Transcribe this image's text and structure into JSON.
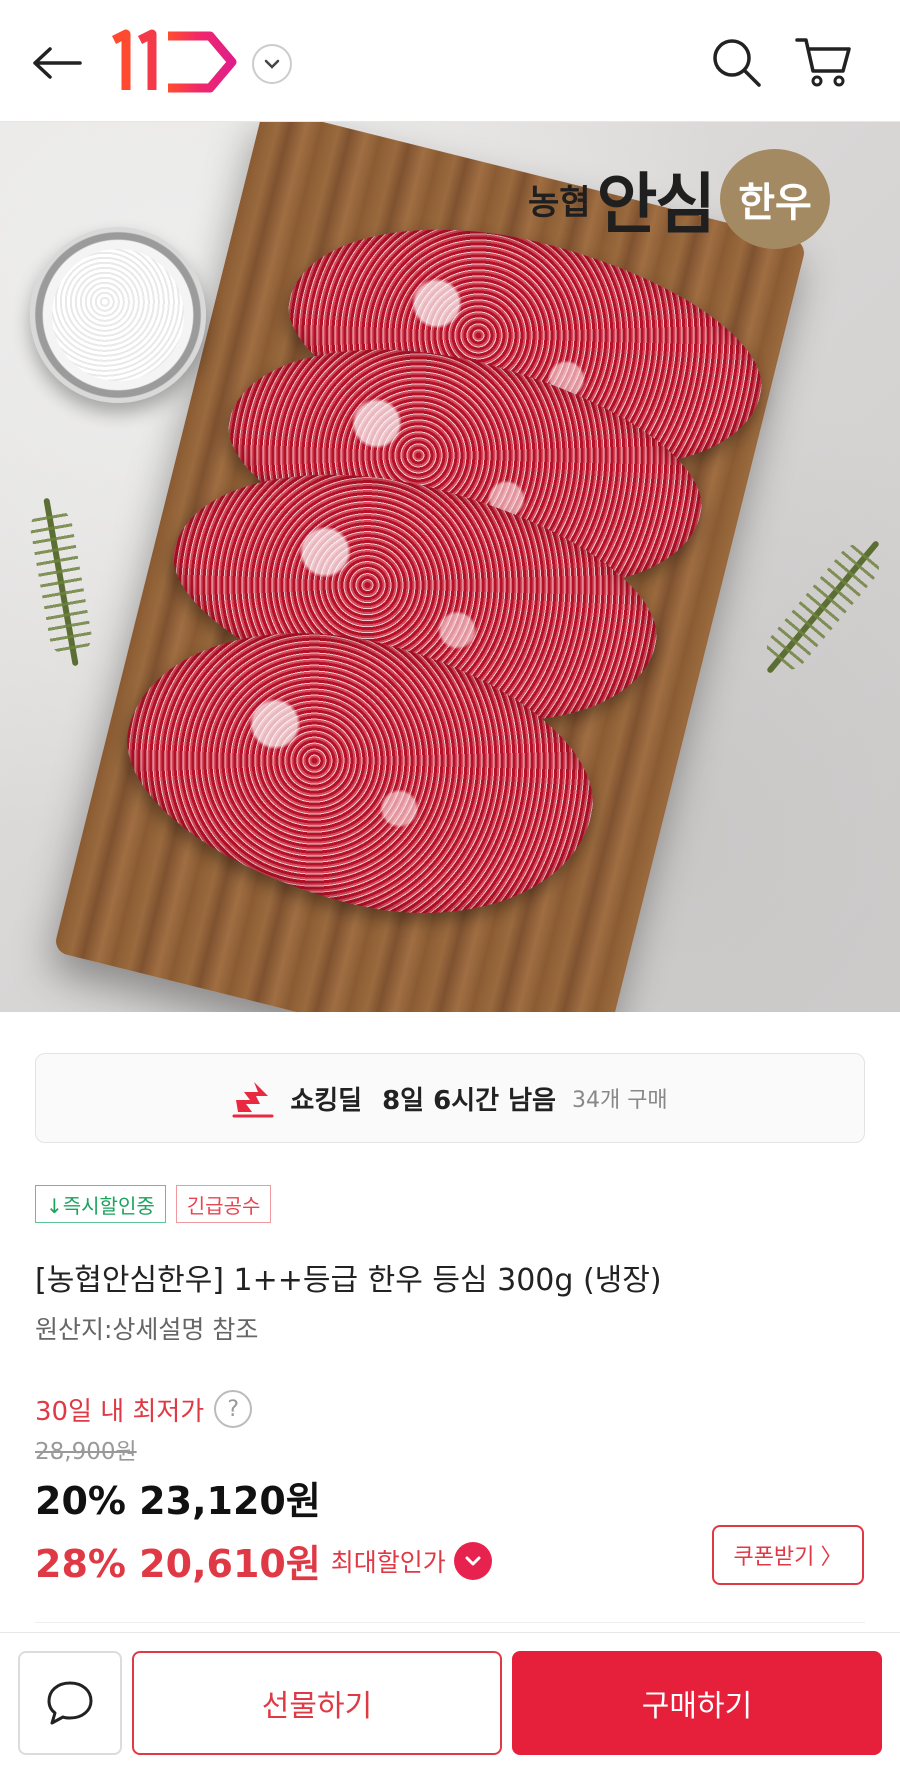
{
  "header": {
    "logo_text": "11",
    "back_icon": "arrow-left-icon",
    "search_icon": "search-icon",
    "cart_icon": "cart-icon",
    "dropdown_icon": "chevron-down-icon"
  },
  "hero": {
    "brand_part1": "농협",
    "brand_part2": "안심",
    "brand_part3": "한우"
  },
  "deal": {
    "label": "쇼킹딜",
    "remaining": "8일 6시간 남음",
    "purchase_count": "34개 구매"
  },
  "badges": {
    "instant_discount": "↓즉시할인중",
    "urgent": "긴급공수"
  },
  "product": {
    "title": "[농협안심한우] 1++등급 한우 등심 300g (냉장)",
    "origin": "원산지:상세설명 참조"
  },
  "price": {
    "lowest_label": "30일 내 최저가",
    "help": "?",
    "original": "28,900원",
    "sale1": "20% 23,120원",
    "sale2": "28% 20,610원",
    "sale2_label": "최대할인가",
    "coupon": "쿠폰받기 〉"
  },
  "bottom": {
    "gift": "선물하기",
    "buy": "구매하기"
  },
  "colors": {
    "accent": "#e03946",
    "buy_bg": "#e6203a",
    "green_badge": "#1ba35e"
  }
}
